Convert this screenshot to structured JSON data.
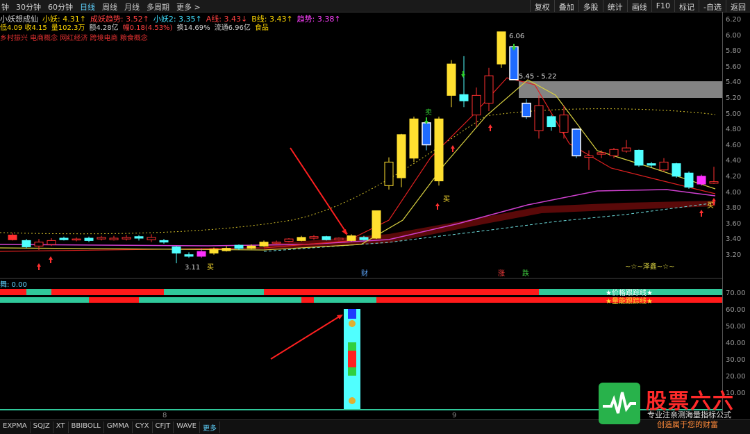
{
  "toolbar": {
    "tabs": [
      {
        "label": "钟",
        "active": false
      },
      {
        "label": "30分钟",
        "active": false
      },
      {
        "label": "60分钟",
        "active": false
      },
      {
        "label": "日线",
        "active": true
      },
      {
        "label": "周线",
        "active": false
      },
      {
        "label": "月线",
        "active": false
      },
      {
        "label": "多周期",
        "active": false
      },
      {
        "label": "更多 >",
        "active": false
      }
    ],
    "buttons": [
      "复权",
      "叠加",
      "多股",
      "统计",
      "画线",
      "F10",
      "标记",
      "-自选",
      "返回"
    ]
  },
  "info": {
    "line1": [
      {
        "text": "小妖想成仙",
        "color": "#d0d0d0"
      },
      {
        "text": "小妖: 4.31↑",
        "color": "#ffd700"
      },
      {
        "text": "成妖趋势: 3.52↑",
        "color": "#ff4040"
      },
      {
        "text": "小妖2: 3.35↑",
        "color": "#40e0ff"
      },
      {
        "text": "A线: 3.43↓",
        "color": "#ff4040"
      },
      {
        "text": "B线: 3.43↑",
        "color": "#ffd700"
      },
      {
        "text": "趋势: 3.38↑",
        "color": "#ff40ff"
      }
    ],
    "line2": [
      {
        "text": "低4.09 收4.15",
        "color": "#ffd700"
      },
      {
        "text": "量102.3万",
        "color": "#ffd700"
      },
      {
        "text": "额4.28亿",
        "color": "#d0d0d0"
      },
      {
        "text": "幅0.18(4.53%)",
        "color": "#ff4040"
      },
      {
        "text": "换14.69%",
        "color": "#d0d0d0"
      },
      {
        "text": "流通6.96亿",
        "color": "#d0d0d0"
      },
      {
        "text": "食品",
        "color": "#ffd700"
      }
    ],
    "line3": "乡村振兴 电商概念 网红经济 跨境电商 粮食概念"
  },
  "price_axis": [
    "6.20",
    "6.00",
    "5.80",
    "5.60",
    "5.40",
    "5.20",
    "5.00",
    "4.80",
    "4.60",
    "4.40",
    "4.20",
    "4.00",
    "3.80",
    "3.60",
    "3.40",
    "3.20"
  ],
  "indicator_axis": [
    "70.00",
    "60.00",
    "50.00",
    "40.00",
    "30.00",
    "20.00",
    "10.00"
  ],
  "chart_labels": {
    "high": "6.06",
    "range": "5.45 - 5.22",
    "low": "3.11",
    "buy": "买",
    "sell": "卖",
    "cai": "财",
    "zhang": "涨",
    "die": "跌",
    "zeyin": "~☆~泽鑫~☆~",
    "price_track": "★价格跟踪线★",
    "volume_track": "★量能跟踪线★",
    "date_8": "8",
    "date_9": "9"
  },
  "indicator": {
    "title": "舞: 0.00"
  },
  "bottom_tabs": [
    "EXPMA",
    "SQJZ",
    "XT",
    "BBIBOLL",
    "GMMA",
    "CYX",
    "CFJT",
    "WAVE"
  ],
  "bottom_more": "更多",
  "brand": {
    "name": "股票六六",
    "slogan1": "专业注亲测海量指标公式",
    "slogan2": "创造属于您的财富"
  },
  "colors": {
    "up": "#ff3030",
    "down_blue": "#1e6bff",
    "cyan": "#50ffff",
    "yellow": "#ffe030",
    "green": "#30c080",
    "bg": "#000000"
  }
}
